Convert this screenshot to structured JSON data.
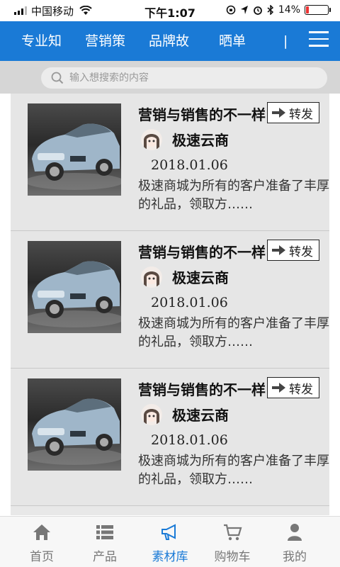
{
  "status_bar": {
    "carrier": "中国移动",
    "time": "下午1:07",
    "battery_percent": "14%",
    "battery_level": 0.14
  },
  "tabs": [
    {
      "label": "专业知"
    },
    {
      "label": "营销策"
    },
    {
      "label": "品牌故"
    },
    {
      "label": "晒单"
    },
    {
      "label": "|"
    }
  ],
  "search": {
    "placeholder": "输入想搜索的内容"
  },
  "articles": [
    {
      "title": "营销与销售的不一样",
      "share_label": "转发",
      "author": "极速云商",
      "date": "2018.01.06",
      "description": "极速商城为所有的客户准备了丰厚的礼品，领取方……"
    },
    {
      "title": "营销与销售的不一样",
      "share_label": "转发",
      "author": "极速云商",
      "date": "2018.01.06",
      "description": "极速商城为所有的客户准备了丰厚的礼品，领取方……"
    },
    {
      "title": "营销与销售的不一样",
      "share_label": "转发",
      "author": "极速云商",
      "date": "2018.01.06",
      "description": "极速商城为所有的客户准备了丰厚的礼品，领取方……"
    }
  ],
  "bottom_nav": [
    {
      "label": "首页",
      "icon": "home-icon"
    },
    {
      "label": "产品",
      "icon": "list-icon"
    },
    {
      "label": "素材库",
      "icon": "megaphone-icon",
      "active": true
    },
    {
      "label": "购物车",
      "icon": "cart-icon"
    },
    {
      "label": "我的",
      "icon": "user-icon"
    }
  ],
  "colors": {
    "accent": "#1a7ad6",
    "inactive": "#777777",
    "battery_low": "#e33333"
  }
}
